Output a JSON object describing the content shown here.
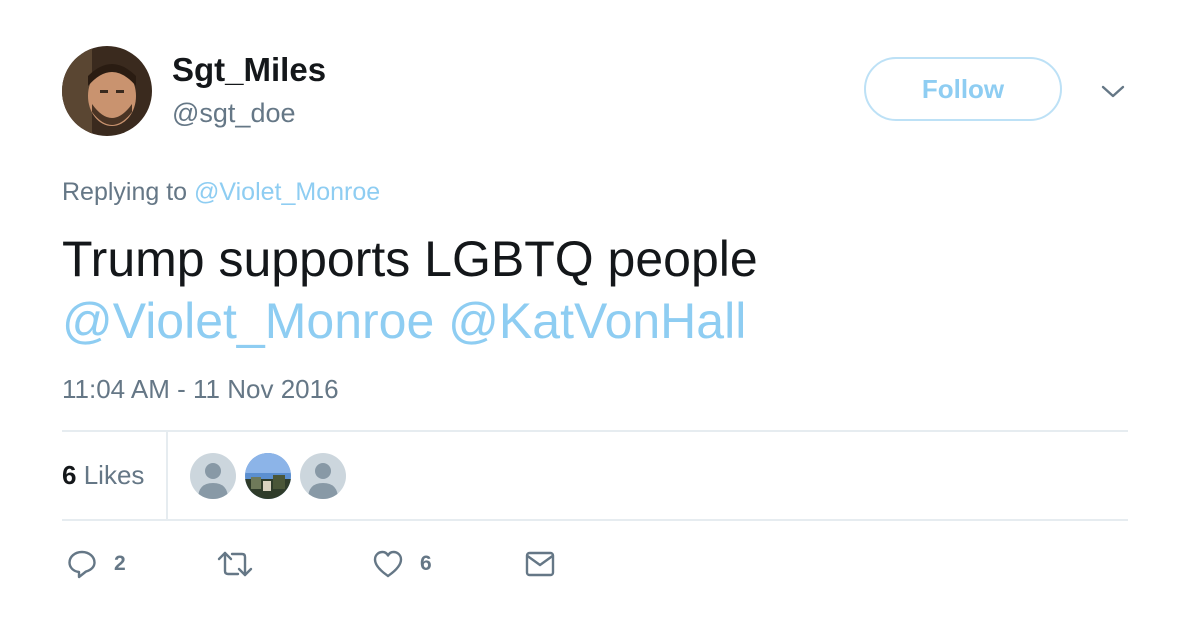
{
  "user": {
    "display_name": "Sgt_Miles",
    "handle": "@sgt_doe"
  },
  "follow_button": {
    "label": "Follow"
  },
  "reply_context": {
    "prefix": "Replying to",
    "mention": "@Violet_Monroe"
  },
  "tweet": {
    "text": "Trump supports LGBTQ people",
    "mention_1": "@Violet_Monroe",
    "mention_2": "@KatVonHall",
    "timestamp": "11:04 AM - 11 Nov 2016"
  },
  "stats": {
    "likes_count": "6",
    "likes_label": "Likes"
  },
  "likers": [
    {
      "icon": "default-avatar-icon"
    },
    {
      "icon": "photo-avatar"
    },
    {
      "icon": "default-avatar-icon"
    }
  ],
  "actions": {
    "reply_count": "2",
    "retweet_count": "",
    "like_count": "6"
  },
  "colors": {
    "link_blue": "#8ecdf2",
    "follow_border": "#bde1f6",
    "secondary_text": "#657786",
    "primary_text": "#14171a",
    "divider": "#e6ecf0"
  }
}
